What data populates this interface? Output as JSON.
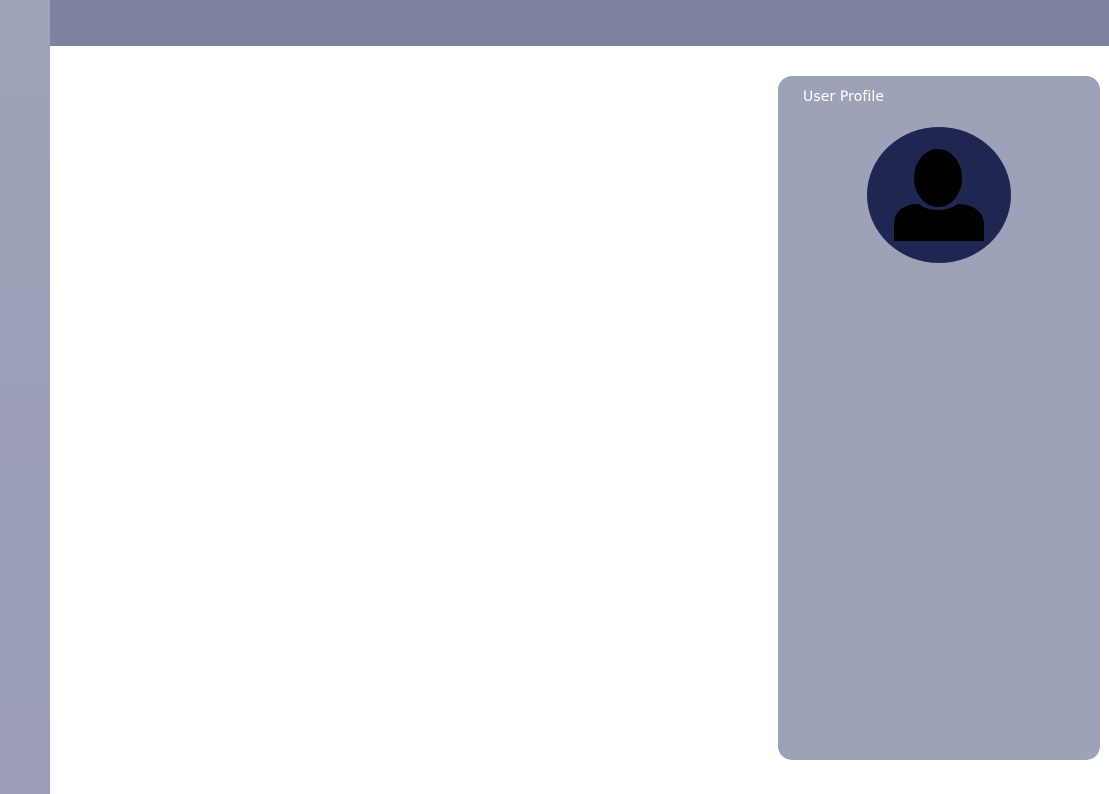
{
  "profile": {
    "title": "User Profile",
    "avatar_icon": "user-silhouette-icon"
  },
  "colors": {
    "topbar": "#7e82a1",
    "sidebar": "#9a9db5",
    "panel": "#9ea2b8",
    "avatar_bg": "#1f2650"
  }
}
